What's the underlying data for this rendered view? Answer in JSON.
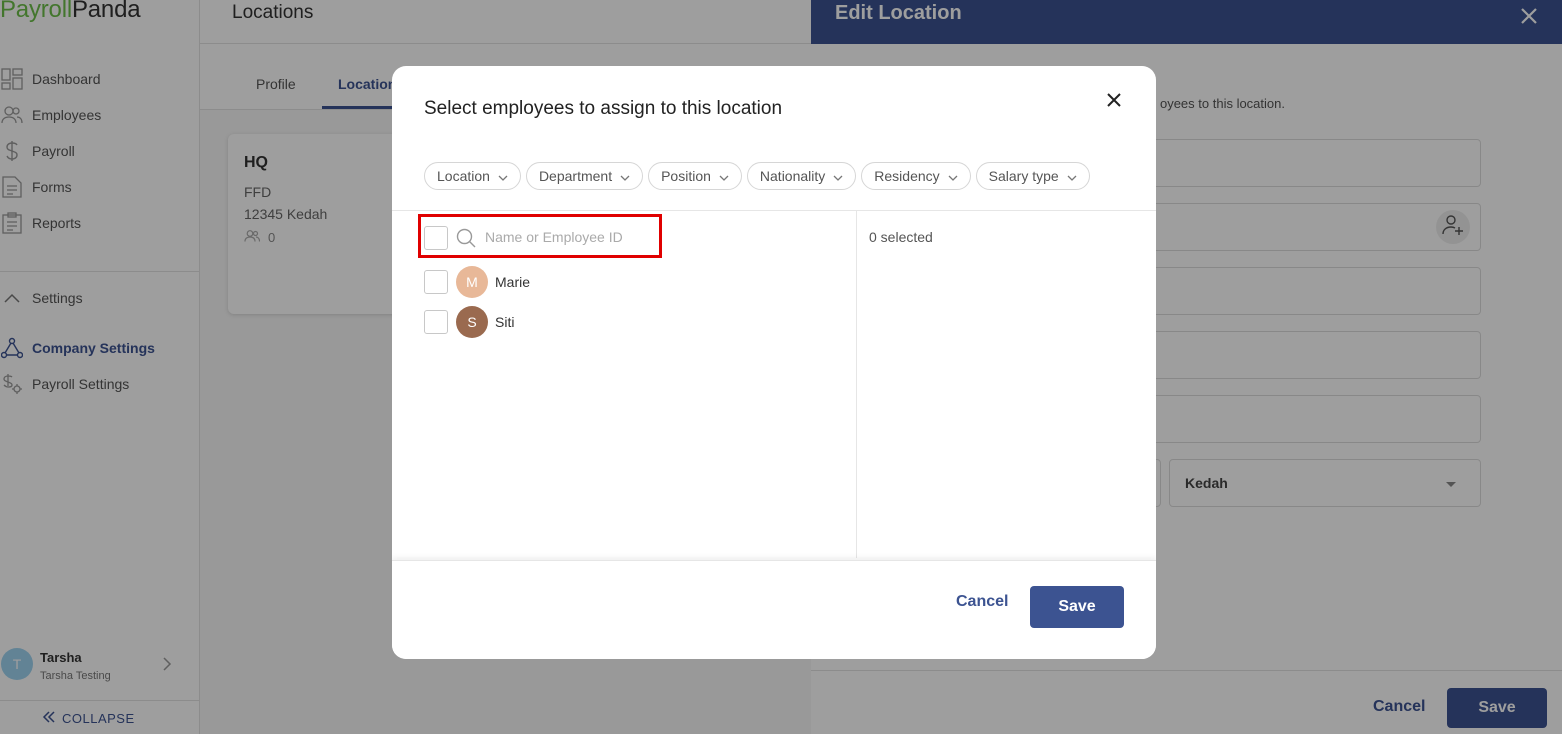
{
  "app": {
    "brand_part1": "Payroll",
    "brand_part2": "Panda"
  },
  "sidebar": {
    "items": [
      {
        "label": "Dashboard",
        "icon": "dashboard-icon"
      },
      {
        "label": "Employees",
        "icon": "employees-icon"
      },
      {
        "label": "Payroll",
        "icon": "dollar-icon"
      },
      {
        "label": "Forms",
        "icon": "forms-icon"
      },
      {
        "label": "Reports",
        "icon": "reports-icon"
      }
    ],
    "settings_label": "Settings",
    "settings_items": [
      {
        "label": "Company Settings",
        "icon": "company-settings-icon",
        "active": true
      },
      {
        "label": "Payroll Settings",
        "icon": "payroll-settings-icon",
        "active": false
      }
    ],
    "user": {
      "initial": "T",
      "name": "Tarsha",
      "company": "Tarsha Testing"
    },
    "collapse_label": "COLLAPSE"
  },
  "main": {
    "title": "Locations",
    "tabs": [
      {
        "label": "Profile",
        "active": false
      },
      {
        "label": "Location",
        "active": true
      }
    ],
    "location_card": {
      "name": "HQ",
      "line1": "FFD",
      "line2": "12345 Kedah",
      "employee_count": "0"
    }
  },
  "drawer": {
    "title": "Edit Location",
    "description_fragment": "oyees to this location.",
    "state_value": "Kedah",
    "cancel_label": "Cancel",
    "save_label": "Save"
  },
  "modal": {
    "title": "Select employees to assign to this location",
    "filters": [
      {
        "label": "Location"
      },
      {
        "label": "Department"
      },
      {
        "label": "Position"
      },
      {
        "label": "Nationality"
      },
      {
        "label": "Residency"
      },
      {
        "label": "Salary type"
      }
    ],
    "search_placeholder": "Name or Employee ID",
    "search_value": "",
    "employees": [
      {
        "initial": "M",
        "name": "Marie",
        "avatar_color": "#e8b898"
      },
      {
        "initial": "S",
        "name": "Siti",
        "avatar_color": "#9a6a4f"
      }
    ],
    "selected_count_label": "0 selected",
    "cancel_label": "Cancel",
    "save_label": "Save"
  },
  "colors": {
    "brand_green": "#6cbf4a",
    "primary": "#3c5391",
    "highlight_red": "#e00000"
  }
}
